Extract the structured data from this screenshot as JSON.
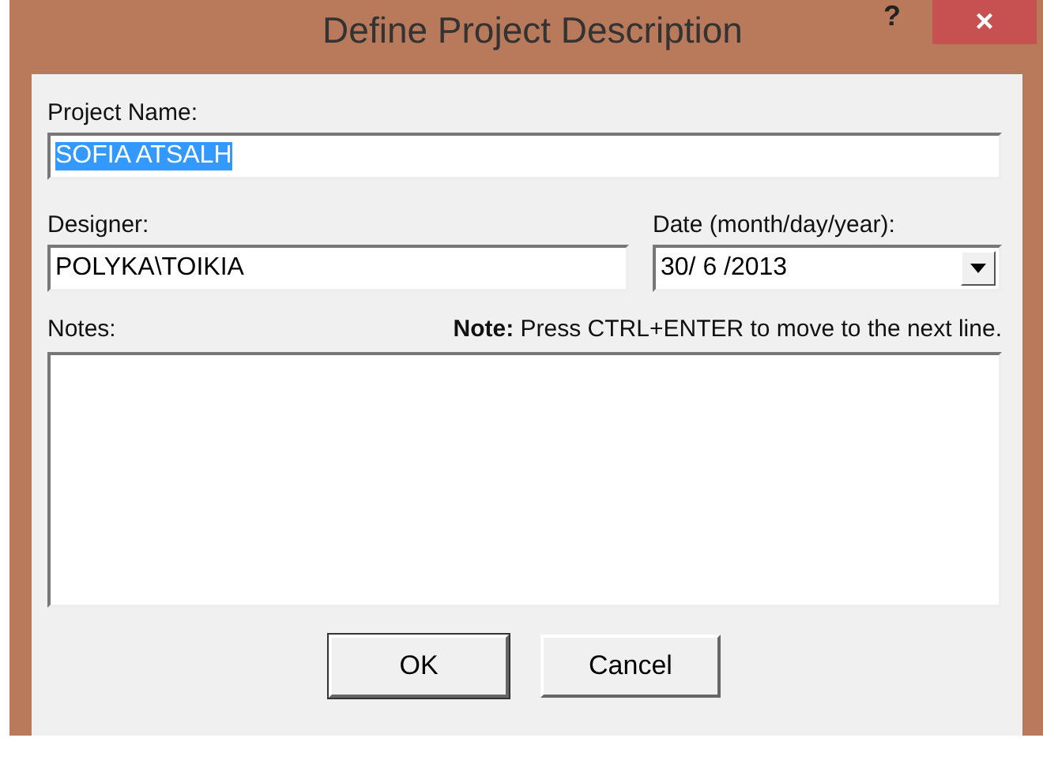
{
  "window": {
    "title": "Define Project Description",
    "help": "?",
    "close": "×"
  },
  "project_name": {
    "label": "Project Name:",
    "value": "SOFIA ATSALH",
    "selected": true
  },
  "designer": {
    "label": "Designer:",
    "value": "POLYKA\\TOIKIA"
  },
  "date": {
    "label": "Date (month/day/year):",
    "value": "30/ 6 /2013"
  },
  "notes": {
    "label": "Notes:",
    "hint": "**Note:**  Press CTRL+ENTER to move to the next line."
  },
  "buttons": [
    {
      "label": "OK",
      "default": true
    },
    {
      "label": "Cancel",
      "default": false
    }
  ]
}
